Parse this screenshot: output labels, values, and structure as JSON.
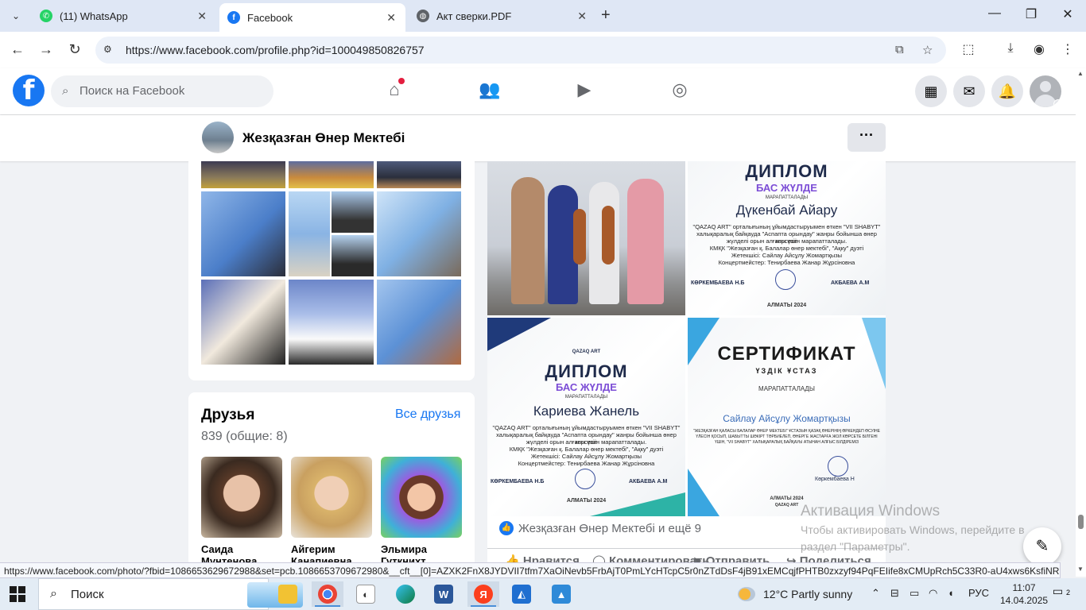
{
  "browser": {
    "tabs": [
      {
        "title": "(11) WhatsApp",
        "favicon_color": "#25d366"
      },
      {
        "title": "Facebook",
        "favicon_color": "#1877f2"
      },
      {
        "title": "Акт сверки.PDF",
        "favicon_color": "#5f6368"
      }
    ],
    "url": "https://www.facebook.com/profile.php?id=100049850826757",
    "status_url": "https://www.facebook.com/photo/?fbid=1086653629672988&set=pcb.1086653709672980&__cft__[0]=AZXK2FnX8JYDVII7tfm7XaOiNevb5FrbAjT0PmLYcHTcpC5r0nZTdDsF4jB91xEMCqjfPHTB0zxzyf94PqFEIife8xCMUpRch5C33R0-aU4xws6KsfiNRbWDA..."
  },
  "facebook": {
    "search_placeholder": "Поиск на Facebook",
    "brand_color": "#1877f2"
  },
  "profile": {
    "name": "Жезқазған Өнер Мектебі",
    "more_label": "···"
  },
  "friends": {
    "title": "Друзья",
    "all_link": "Все друзья",
    "count": "839 (общие: 8)",
    "items": [
      {
        "name": "Саида Мунтенова"
      },
      {
        "name": "Айгерим Канапиевна"
      },
      {
        "name": "Эльмира Гуткнихт"
      }
    ]
  },
  "post": {
    "diploma1": {
      "title": "ДИПЛОМ",
      "subtitle": "БАС ЖҮЛДЕ",
      "award_word": "МАРАПАТТАЛАДЫ",
      "name": "Дүкенбай Айару",
      "line1": "\"QAZAQ ART\" орталығының ұйымдастыруымен өткен \"VII SHABYT\"",
      "line2": "халықаралық байқауда \"Аспапта орындау\" жанры бойынша өнер көрсетіп",
      "line3": "жүлделі орын алғаны үшін марапатталады.",
      "line4": "КМҚК \"Жезқазған қ. Балалар өнер мектебі\", \"Ақку\" дуэті",
      "line5": "Жетекшісі: Сайлау Айсұлу Жомартқызы",
      "line6": "Концертмейстер: Тенирбаева Жанар Жұрсіновна",
      "sig_left": "КӨРКЕМБАЕВА Н.Б",
      "sig_right": "АКБАЕВА А.М",
      "city": "АЛМАТЫ 2024"
    },
    "diploma2": {
      "logo": "QAZAQ ART",
      "title": "ДИПЛОМ",
      "subtitle": "БАС ЖҮЛДЕ",
      "award_word": "МАРАПАТТАЛАДЫ",
      "name": "Кариева Жанель",
      "line1": "\"QAZAQ ART\" орталығының ұйымдастыруымен өткен \"VII SHABYT\"",
      "line2": "халықаралық байқауда \"Аспапта орындау\" жанры бойынша өнер көрсетіп",
      "line3": "жүлделі орын алғаны үшін марапатталады.",
      "line4": "КМҚК \"Жезқазған қ. Балалар өнер мектебі\", \"Ақку\" дуэті",
      "line5": "Жетекшісі: Сайлау Айсұлу Жомартқызы",
      "line6": "Концертмейстер: Тенирбаева Жанар Жұрсіновна",
      "sig_left": "КӨРКЕМБАЕВА Н.Б",
      "sig_right": "АКБАЕВА А.М",
      "city": "АЛМАТЫ 2024"
    },
    "certificate": {
      "title": "СЕРТИФИКАТ",
      "subtitle": "ҮЗДІК ҰСТАЗ",
      "award_word": "МАРАПАТТАЛАДЫ",
      "name": "Сайлау Айсұлу Жомартқызы",
      "text": "\"ЖЕЗҚАЗҒАН ҚАЛАСЫ БАЛАЛАР ӨНЕР МЕКТЕБІ\" ҰСТАЗЫН ҚАЗАҚ ӨНЕРІНІҢ ӨРКЕНДЕП ӨСУІНЕ ҮЛЕСІН ҚОСЫП, ШАБЫТТЫ ШӘКІРТ ТӘРБИЕЛЕП, ӨНЕРГЕ ЖАСТАРҒА ЖОЛ КӨРСЕТЕ БІЛГЕНІ ҮШІН, \"VII SHABYT\" ХАЛЫҚАРАЛЫҚ БАЙҚАУЫ АТЫНАН АЛҒЫС БІЛДІРЕМІЗ",
      "sig": "Көркембаева Н",
      "city": "АЛМАТЫ 2024",
      "logo": "QAZAQ ART"
    },
    "reactions_text": "Жезқазған Өнер Мектебі и ещё 9",
    "actions": {
      "like": "Нравится",
      "comment": "Комментировать",
      "send": "Отправить",
      "share": "Поделиться"
    }
  },
  "windows_watermark": {
    "title": "Активация Windows",
    "text": "Чтобы активировать Windows, перейдите в раздел \"Параметры\"."
  },
  "taskbar": {
    "search_label": "Поиск",
    "weather": "12°C  Partly sunny",
    "language": "РУС",
    "time": "11:07",
    "date": "14.04.2025",
    "notifications": "2"
  }
}
